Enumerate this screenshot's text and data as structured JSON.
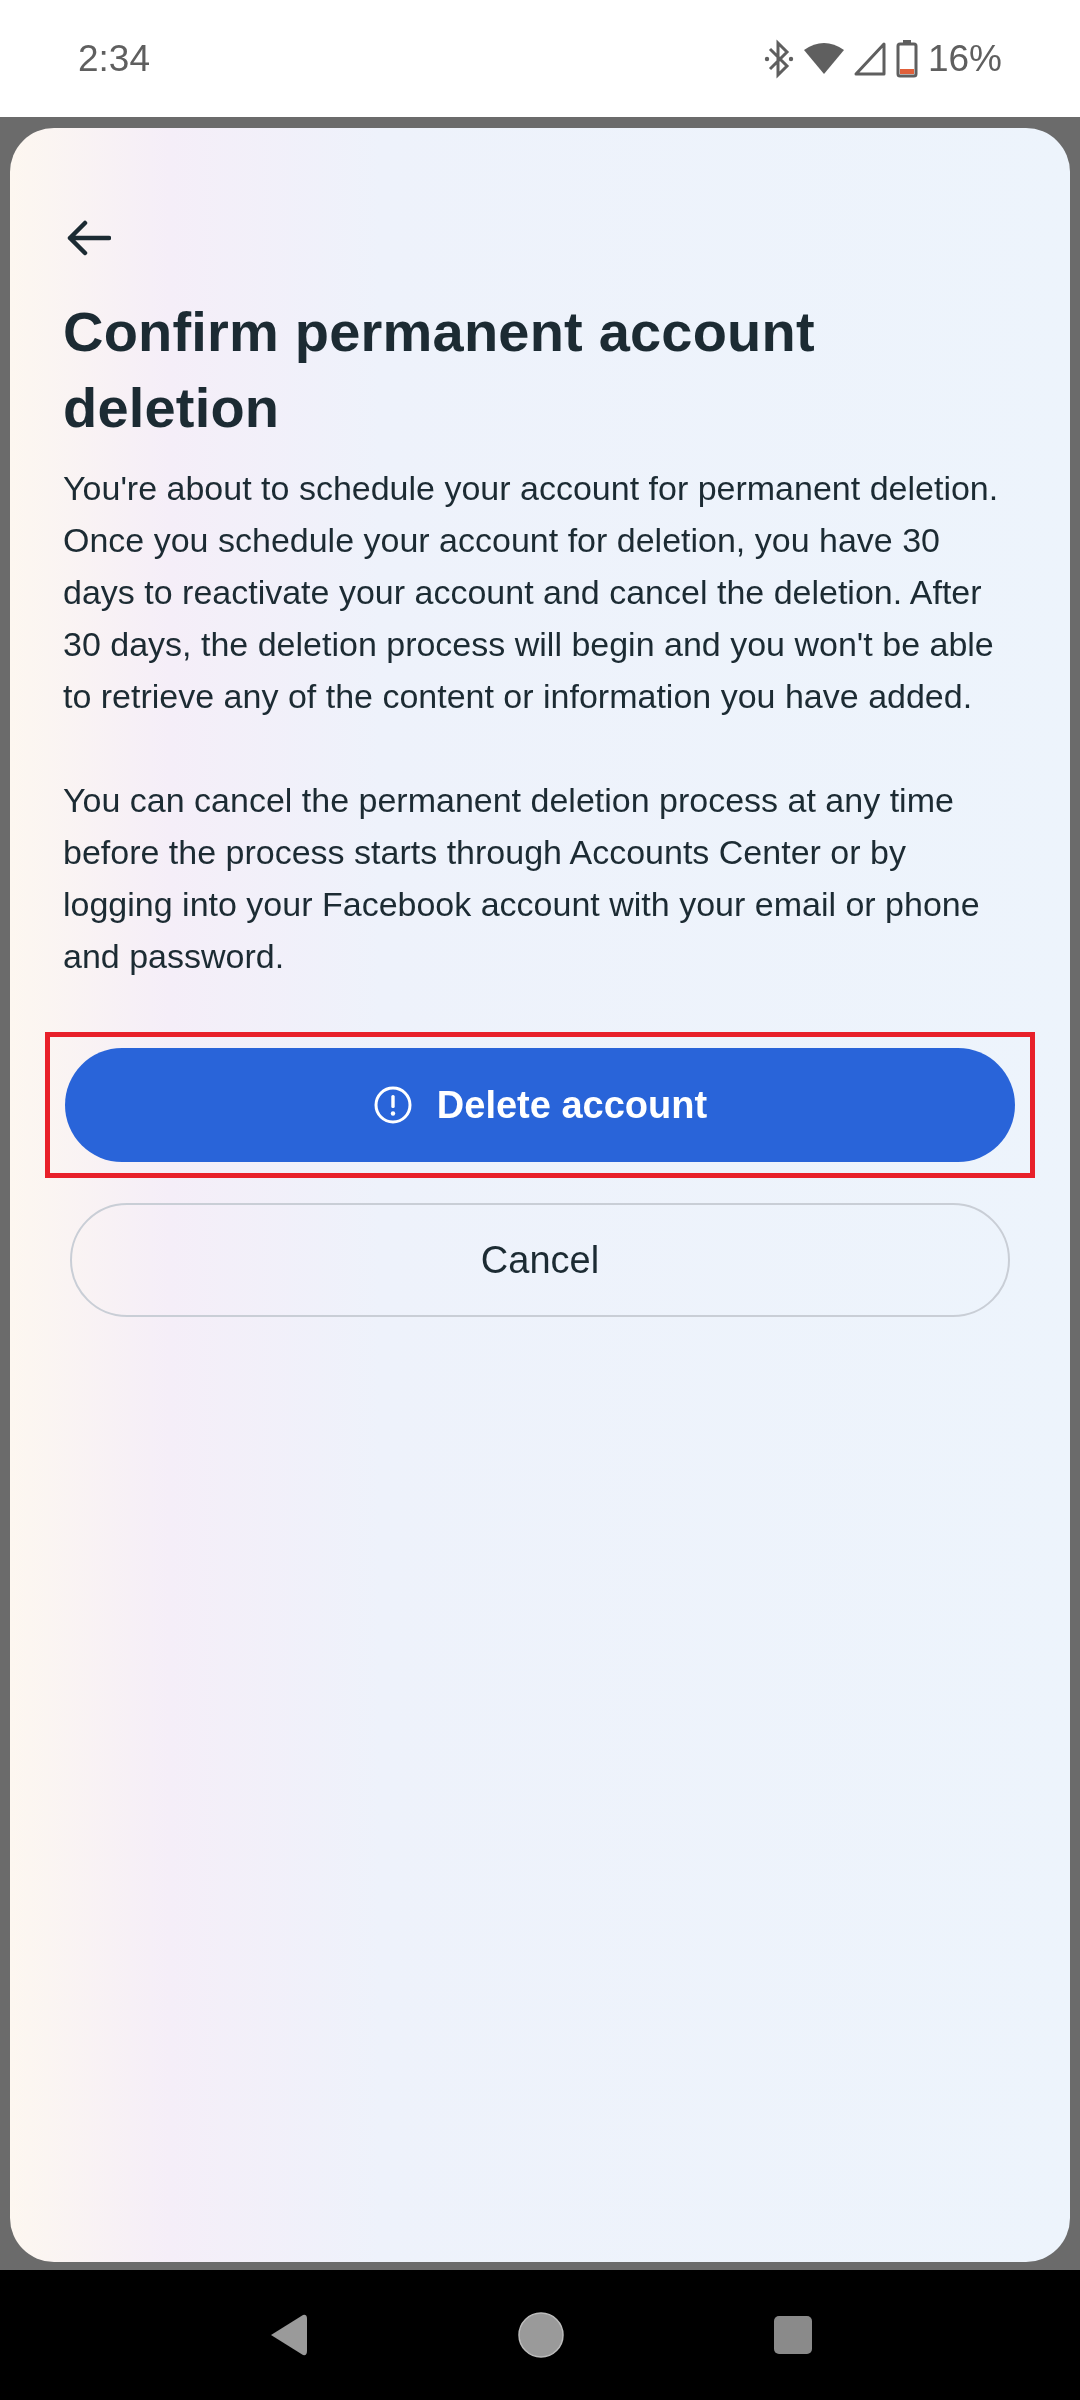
{
  "status_bar": {
    "time": "2:34",
    "battery": "16%"
  },
  "sheet": {
    "title": "Confirm permanent account deletion",
    "paragraphs": [
      "You're about to schedule your account for permanent deletion. Once you schedule your account for deletion, you have 30 days to reactivate your account and cancel the deletion. After 30 days, the deletion process will begin and you won't be able to retrieve any of the content or information you have added.",
      "You can cancel the permanent deletion process at any time before the process starts through Accounts Center or by logging into your Facebook account with your email or phone and password."
    ],
    "buttons": [
      {
        "kind": "primary",
        "label": "Delete account",
        "highlighted": true
      },
      {
        "kind": "secondary",
        "label": "Cancel",
        "highlighted": false
      }
    ]
  }
}
